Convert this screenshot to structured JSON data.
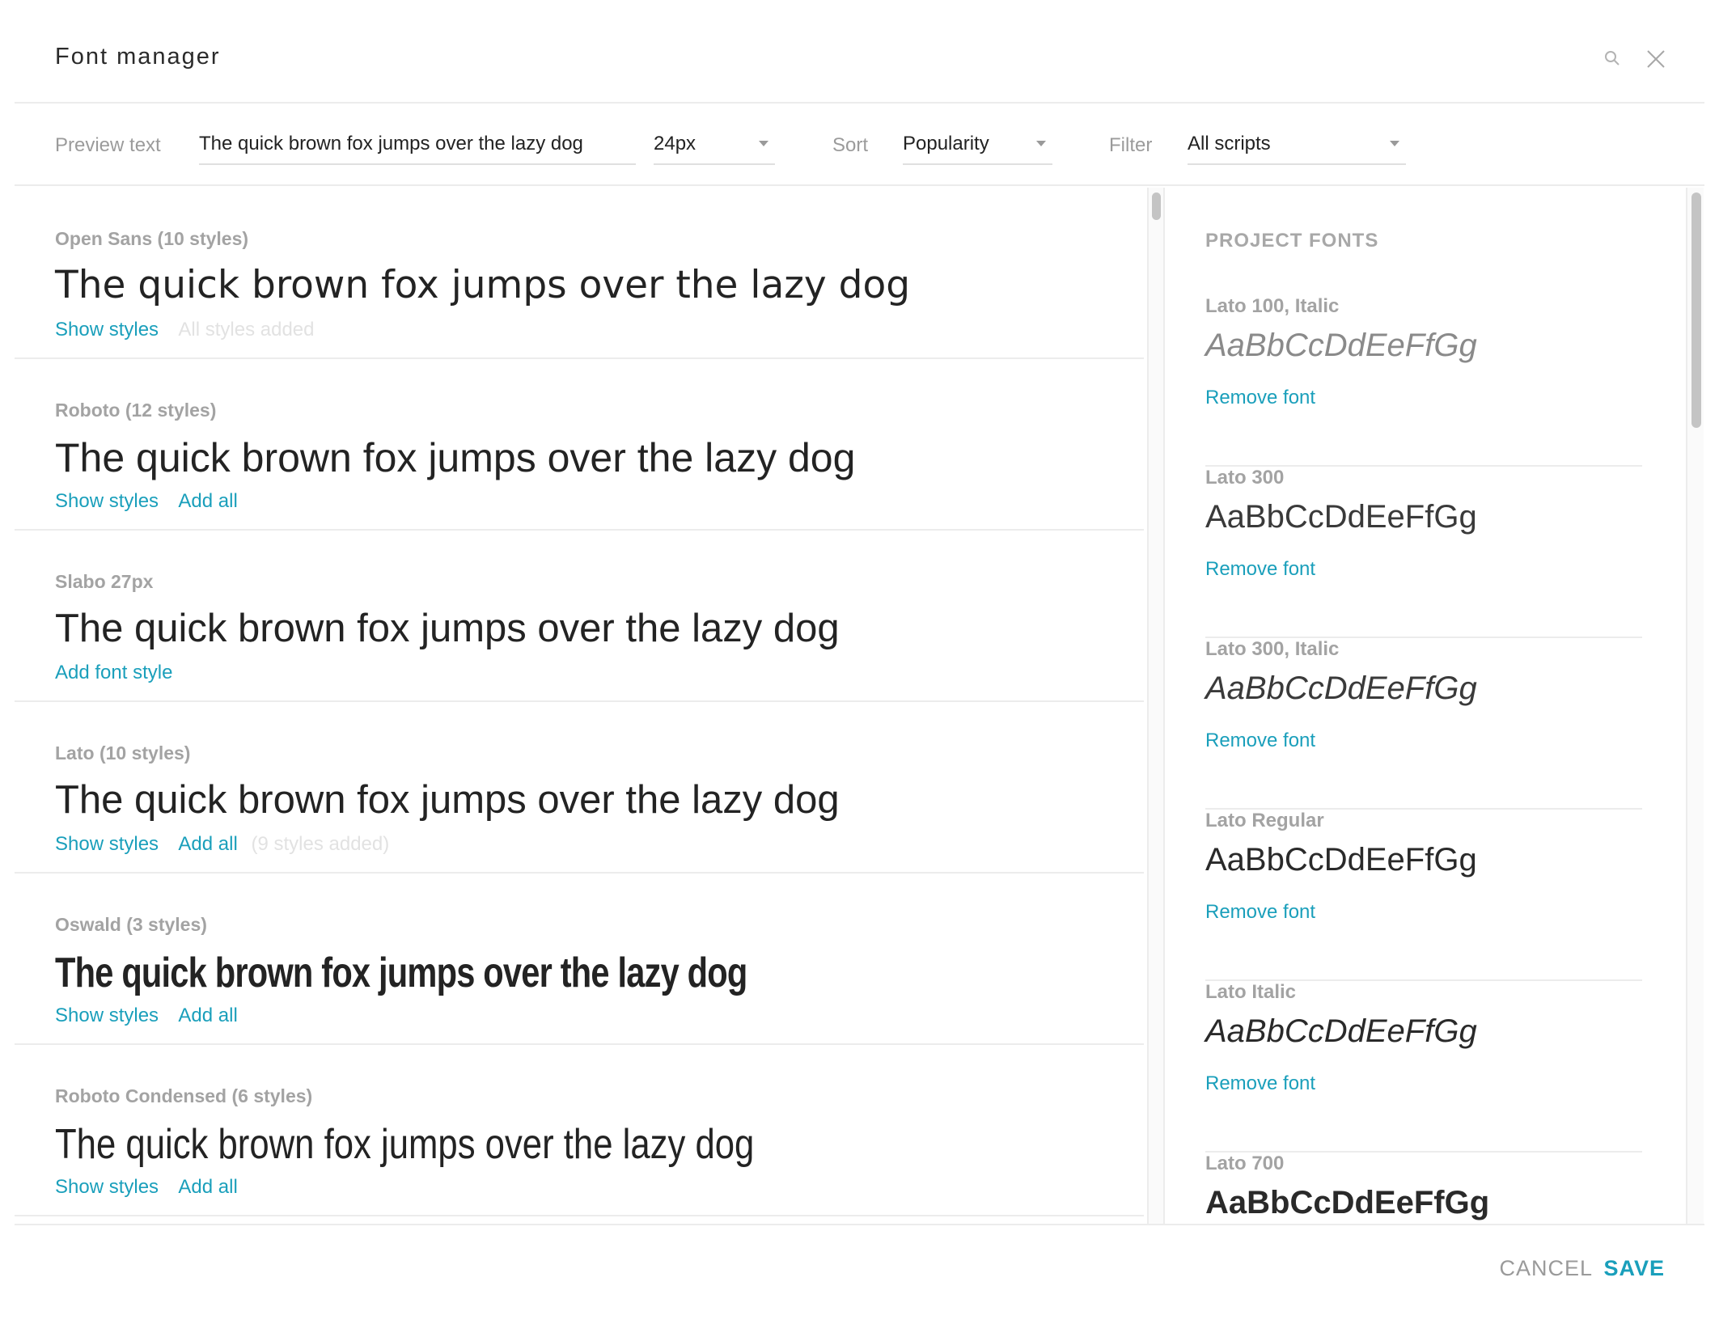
{
  "window": {
    "title": "Font manager"
  },
  "toolbar": {
    "preview_label": "Preview text",
    "preview_value": "The quick brown fox jumps over the lazy dog",
    "size_value": "24px",
    "sort_label": "Sort",
    "sort_value": "Popularity",
    "filter_label": "Filter",
    "filter_value": "All scripts"
  },
  "fonts": [
    {
      "name": "Open Sans (10 styles)",
      "preview": "The quick brown fox jumps over the lazy dog",
      "show_styles": "Show styles",
      "status": "All styles added"
    },
    {
      "name": "Roboto (12 styles)",
      "preview": "The quick brown fox jumps over the lazy dog",
      "show_styles": "Show styles",
      "add_all": "Add all"
    },
    {
      "name": "Slabo 27px",
      "preview": "The quick brown fox jumps over the lazy dog",
      "add_style": "Add font style"
    },
    {
      "name": "Lato (10 styles)",
      "preview": "The quick brown fox jumps over the lazy dog",
      "show_styles": "Show styles",
      "add_all": "Add all",
      "status": "(9 styles added)"
    },
    {
      "name": "Oswald (3 styles)",
      "preview": "The quick brown fox jumps over the lazy dog",
      "show_styles": "Show styles",
      "add_all": "Add all"
    },
    {
      "name": "Roboto Condensed (6 styles)",
      "preview": "The quick brown fox jumps over the lazy dog",
      "show_styles": "Show styles",
      "add_all": "Add all"
    }
  ],
  "project": {
    "heading": "PROJECT FONTS",
    "items": [
      {
        "name": "Lato 100, Italic",
        "sample": "AaBbCcDdEeFfGg",
        "remove": "Remove font"
      },
      {
        "name": "Lato 300",
        "sample": "AaBbCcDdEeFfGg",
        "remove": "Remove font"
      },
      {
        "name": "Lato 300, Italic",
        "sample": "AaBbCcDdEeFfGg",
        "remove": "Remove font"
      },
      {
        "name": "Lato Regular",
        "sample": "AaBbCcDdEeFfGg",
        "remove": "Remove font"
      },
      {
        "name": "Lato Italic",
        "sample": "AaBbCcDdEeFfGg",
        "remove": "Remove font"
      },
      {
        "name": "Lato 700",
        "sample": "AaBbCcDdEeFfGg"
      }
    ]
  },
  "footer": {
    "cancel_label": "CANCEL",
    "save_label": "SAVE"
  },
  "colors": {
    "accent": "#1a9fbb",
    "muted_text": "#a3a3a3",
    "divider": "#ececec"
  }
}
